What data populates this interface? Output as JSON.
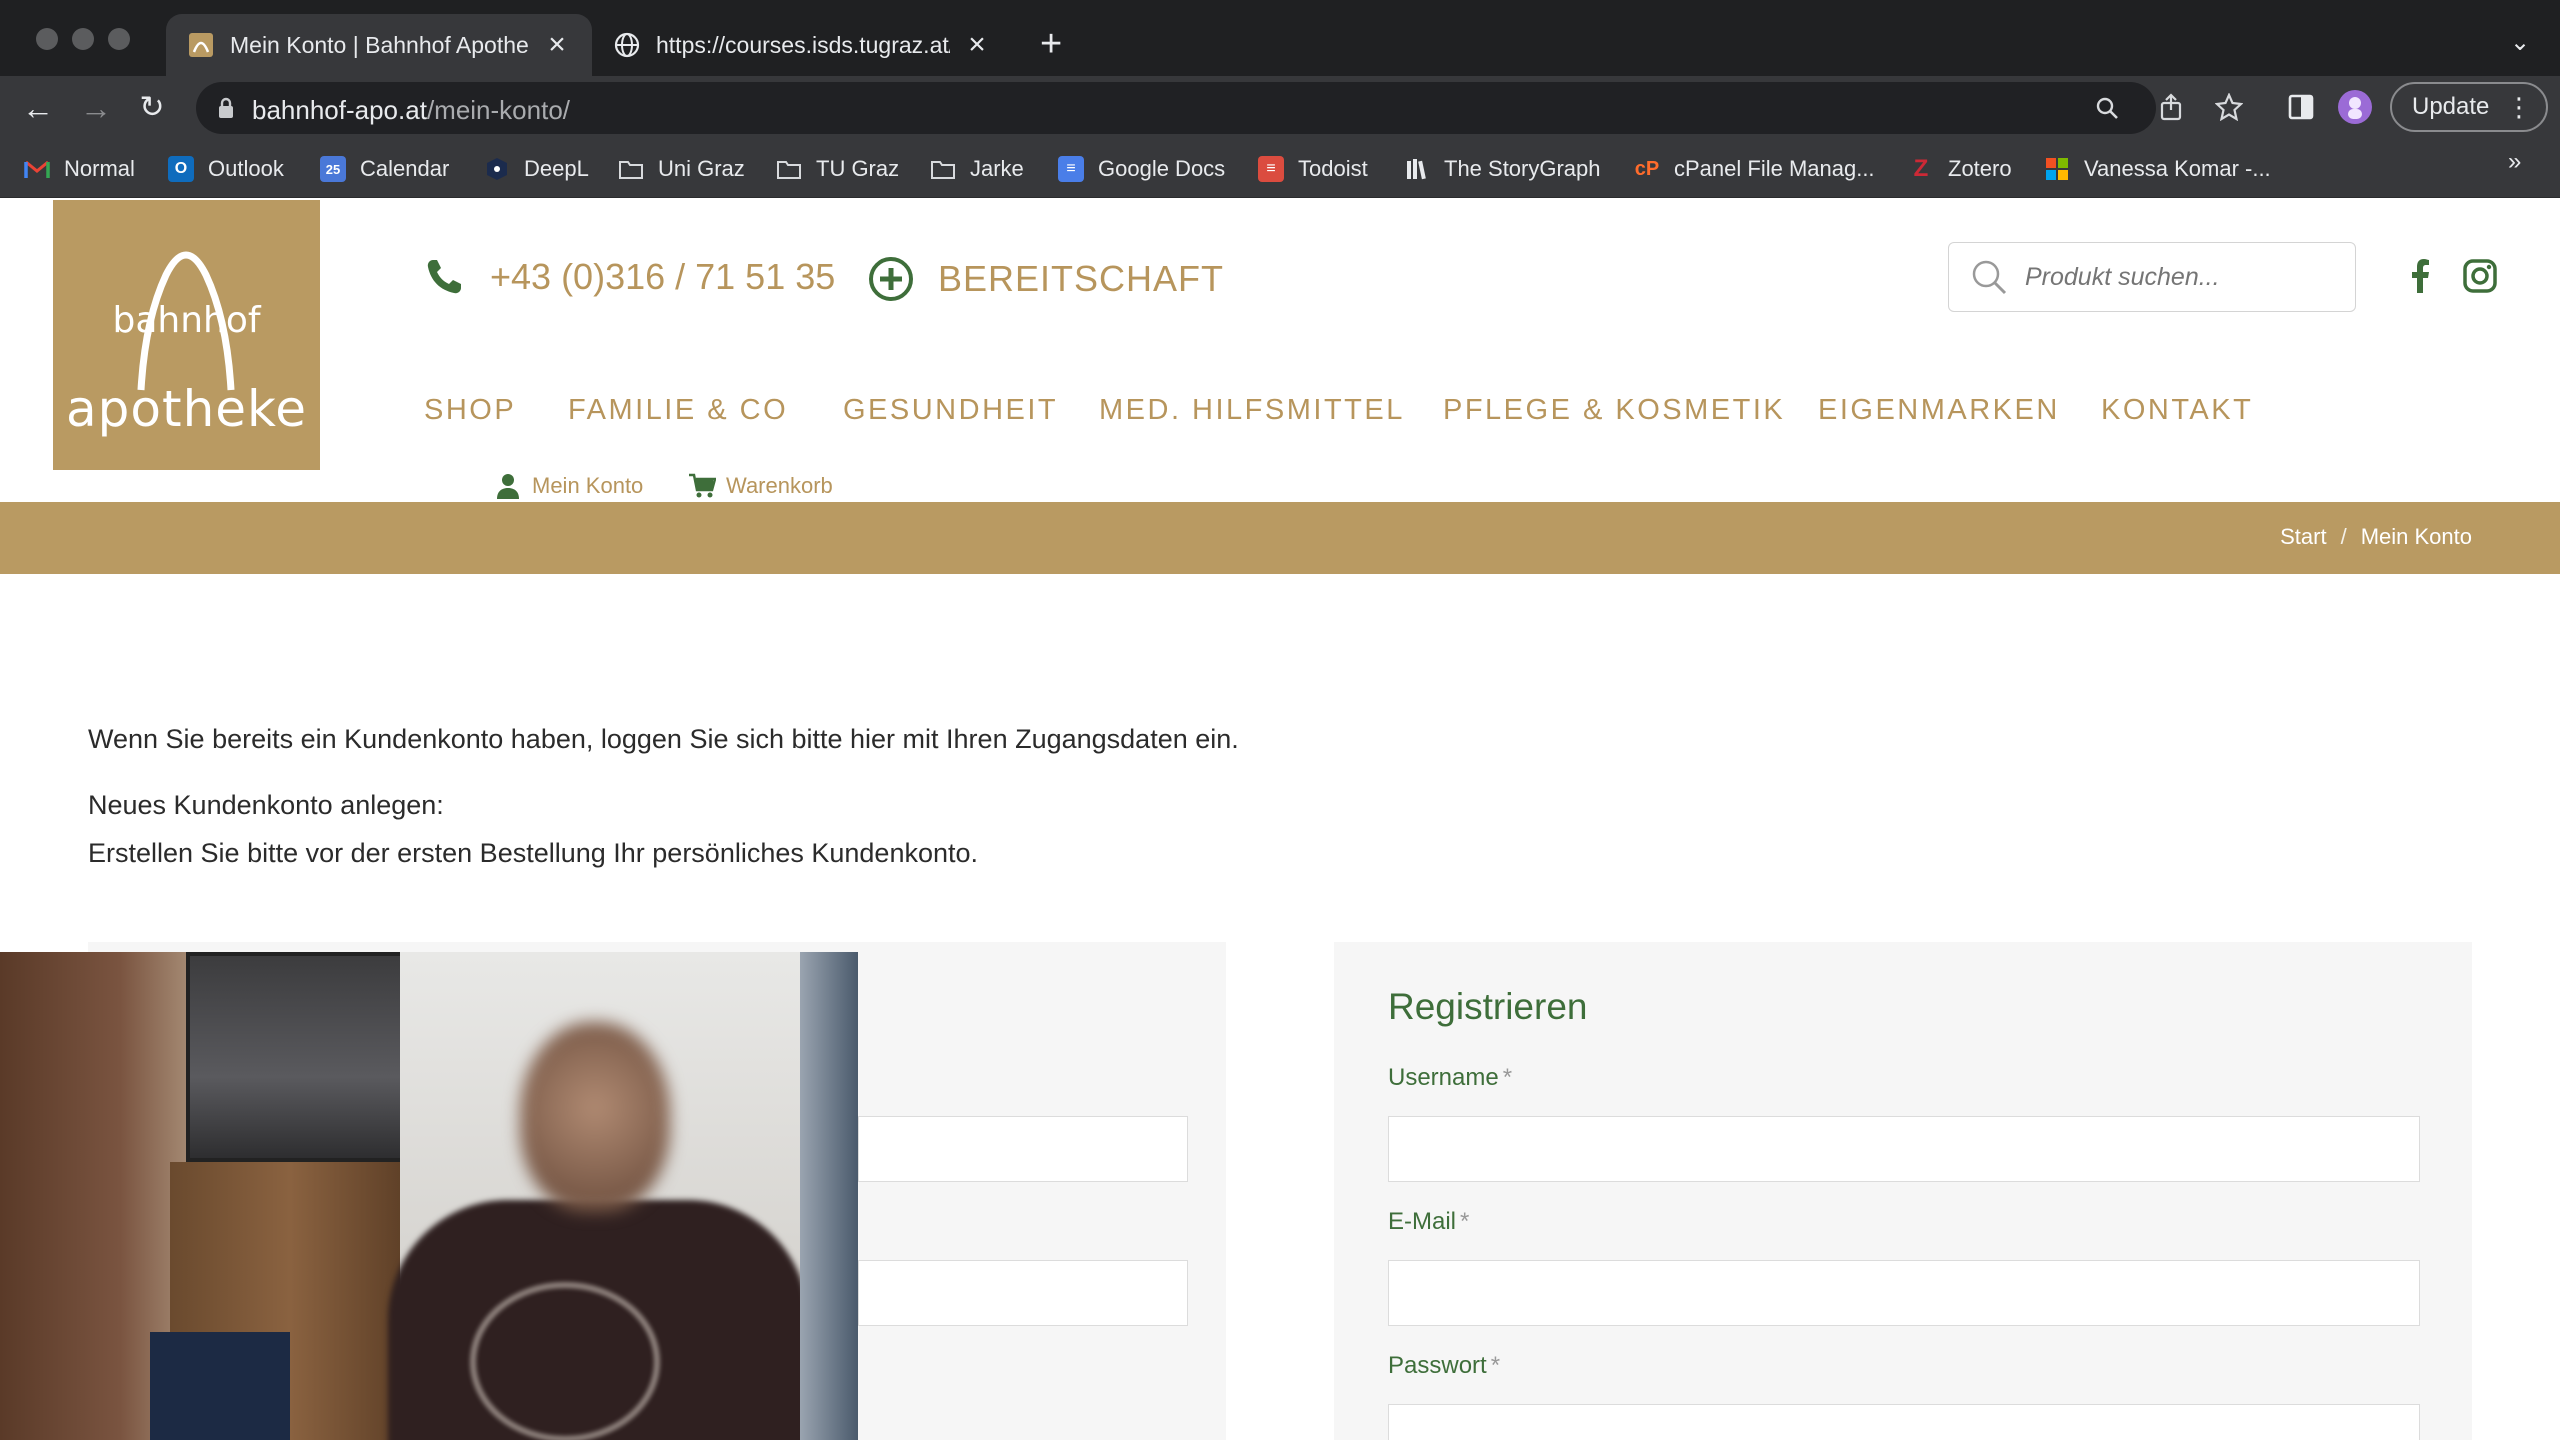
{
  "browser": {
    "tabs": [
      {
        "title": "Mein Konto | Bahnhof Apotheke",
        "active": true
      },
      {
        "title": "https://courses.isds.tugraz.at/i",
        "active": false
      }
    ],
    "url_domain": "bahnhof-apo.at",
    "url_path": "/mein-konto/",
    "update_label": "Update",
    "bookmarks": [
      {
        "label": "Normal",
        "icon": "gmail-icon"
      },
      {
        "label": "Outlook",
        "icon": "outlook-icon"
      },
      {
        "label": "Calendar",
        "icon": "calendar-icon"
      },
      {
        "label": "DeepL",
        "icon": "deepl-icon"
      },
      {
        "label": "Uni Graz",
        "icon": "folder-icon"
      },
      {
        "label": "TU Graz",
        "icon": "folder-icon"
      },
      {
        "label": "Jarke",
        "icon": "folder-icon"
      },
      {
        "label": "Google Docs",
        "icon": "docs-icon"
      },
      {
        "label": "Todoist",
        "icon": "todoist-icon"
      },
      {
        "label": "The StoryGraph",
        "icon": "storygraph-icon"
      },
      {
        "label": "cPanel File Manag...",
        "icon": "cpanel-icon"
      },
      {
        "label": "Zotero",
        "icon": "zotero-icon"
      },
      {
        "label": "Vanessa Komar -...",
        "icon": "microsoft-icon"
      }
    ]
  },
  "site": {
    "logo_line1": "bahnhof",
    "logo_line2": "apotheke",
    "phone": "+43 (0)316 / 71 51 35",
    "bereitschaft": "BEREITSCHAFT",
    "search_placeholder": "Produkt suchen...",
    "nav": [
      "SHOP",
      "FAMILIE & CO",
      "GESUNDHEIT",
      "MED. HILFSMITTEL",
      "PFLEGE & KOSMETIK",
      "EIGENMARKEN",
      "KONTAKT"
    ],
    "account_link": "Mein Konto",
    "cart_link": "Warenkorb",
    "breadcrumb": {
      "start": "Start",
      "separator": "/",
      "current": "Mein Konto"
    },
    "intro_login": "Wenn Sie bereits ein Kundenkonto haben, loggen Sie sich bitte hier mit Ihren Zugangsdaten ein.",
    "intro_new_title": "Neues Kundenkonto anlegen:",
    "intro_new_text": "Erstellen Sie bitte vor der ersten Bestellung Ihr persönliches Kundenkonto.",
    "register": {
      "title": "Registrieren",
      "username_label": "Username",
      "email_label": "E-Mail",
      "password_label": "Passwort",
      "required_mark": "*"
    },
    "colors": {
      "gold": "#b99a62",
      "green": "#3e6e3a"
    }
  }
}
